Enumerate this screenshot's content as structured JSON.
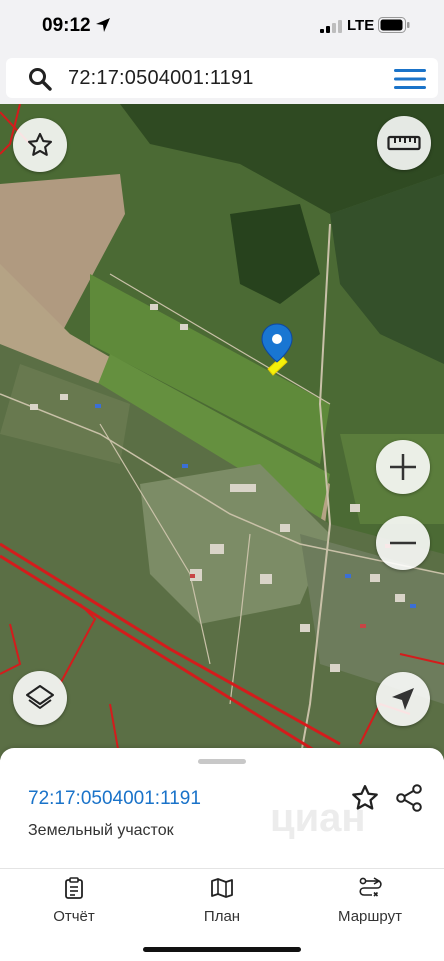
{
  "status_bar": {
    "time": "09:12",
    "network": "LTE"
  },
  "search": {
    "query": "72:17:0504001:1191"
  },
  "map": {
    "buttons": [
      "favorite-icon",
      "ruler-icon",
      "zoom-in-icon",
      "zoom-out-icon",
      "layers-icon",
      "locate-icon"
    ],
    "parcel_color": "#f4f10a",
    "marker_color": "#1976d2",
    "boundary_color": "#d41c1c"
  },
  "sheet": {
    "parcel_id": "72:17:0504001:1191",
    "parcel_type": "Земельный участок",
    "watermark": "циан"
  },
  "nav": {
    "items": [
      {
        "label": "Отчёт",
        "icon": "report-icon"
      },
      {
        "label": "План",
        "icon": "map-icon"
      },
      {
        "label": "Маршрут",
        "icon": "route-icon"
      }
    ]
  },
  "colors": {
    "accent": "#1a73c9",
    "menu": "#1a73c9"
  }
}
